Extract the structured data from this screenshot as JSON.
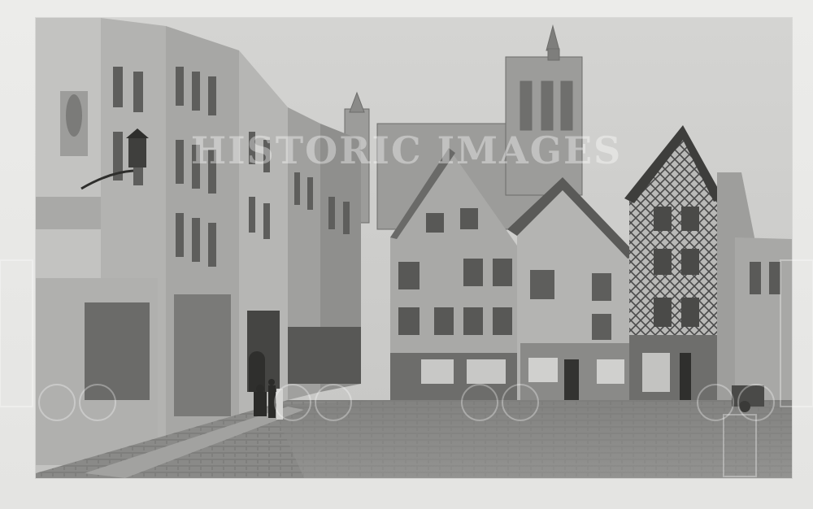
{
  "photo": {
    "subject": "street-scene",
    "tone": "sepia-grayscale"
  },
  "watermark": {
    "text": "HISTORIC IMAGES"
  },
  "colors": {
    "sky": "#cfcfcd",
    "paper": "#e9e9e7",
    "street": "#8e8e8c",
    "dark_facade": "#5b5b5b"
  }
}
